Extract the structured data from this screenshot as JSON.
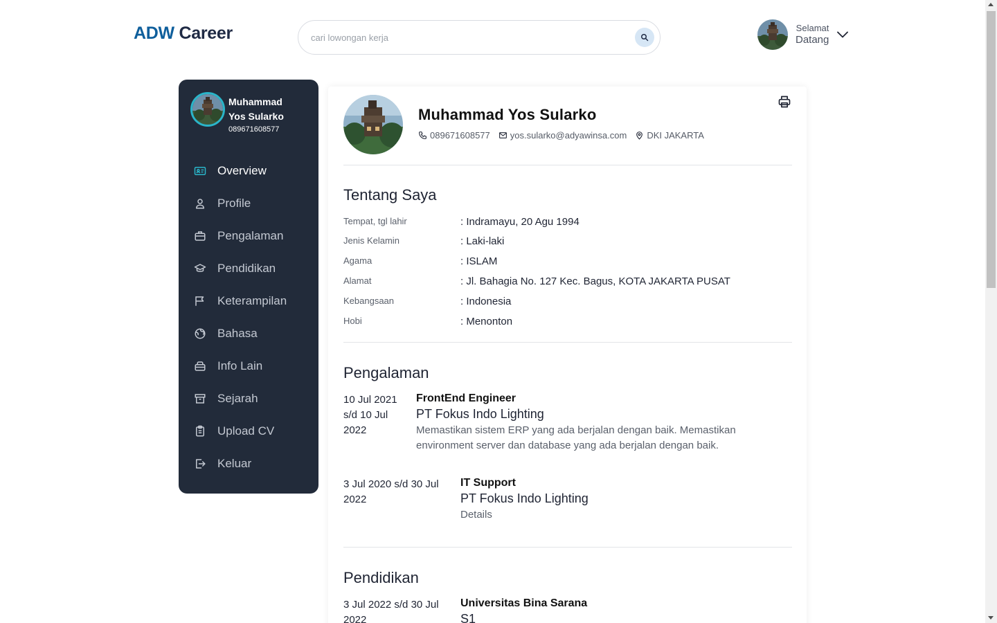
{
  "header": {
    "brand_part1": "ADW",
    "brand_part2": "Career",
    "search_placeholder": "cari lowongan kerja",
    "greeting_line1": "Selamat",
    "greeting_line2": "Datang"
  },
  "sidebar": {
    "name": "Muhammad Yos Sularko",
    "phone": "089671608577",
    "items": [
      {
        "label": "Overview",
        "icon": "id-card-icon",
        "active": true
      },
      {
        "label": "Profile",
        "icon": "user-icon"
      },
      {
        "label": "Pengalaman",
        "icon": "briefcase-icon"
      },
      {
        "label": "Pendidikan",
        "icon": "graduation-cap-icon"
      },
      {
        "label": "Keterampilan",
        "icon": "flag-icon"
      },
      {
        "label": "Bahasa",
        "icon": "globe-icon"
      },
      {
        "label": "Info Lain",
        "icon": "archive-box-icon"
      },
      {
        "label": "Sejarah",
        "icon": "archive-icon"
      },
      {
        "label": "Upload CV",
        "icon": "clipboard-icon"
      },
      {
        "label": "Keluar",
        "icon": "logout-icon"
      }
    ]
  },
  "profile": {
    "name": "Muhammad Yos Sularko",
    "phone": "089671608577",
    "email": "yos.sularko@adyawinsa.com",
    "location": "DKI JAKARTA"
  },
  "about": {
    "title": "Tentang Saya",
    "rows": [
      {
        "key": "Tempat, tgl lahir",
        "value": ": Indramayu, 20 Agu 1994"
      },
      {
        "key": "Jenis Kelamin",
        "value": ": Laki-laki"
      },
      {
        "key": "Agama",
        "value": ": ISLAM"
      },
      {
        "key": "Alamat",
        "value": ": Jl. Bahagia No. 127 Kec. Bagus, KOTA JAKARTA PUSAT"
      },
      {
        "key": "Kebangsaan",
        "value": ": Indonesia"
      },
      {
        "key": "Hobi",
        "value": ": Menonton"
      }
    ]
  },
  "experience": {
    "title": "Pengalaman",
    "items": [
      {
        "date": "10 Jul 2021 s/d 10 Jul 2022",
        "role": "FrontEnd Engineer",
        "company": "PT Fokus Indo Lighting",
        "desc": "Memastikan sistem ERP yang ada berjalan dengan baik. Memastikan environment server dan database yang ada berjalan dengan baik."
      },
      {
        "date": "3 Jul 2020 s/d 30 Jul 2022",
        "role": "IT Support",
        "company": "PT Fokus Indo Lighting",
        "desc": "Details"
      }
    ]
  },
  "education": {
    "title": "Pendidikan",
    "items": [
      {
        "date": "3 Jul 2022 s/d 30 Jul 2022",
        "school": "Universitas Bina Sarana",
        "degree": "S1"
      }
    ]
  },
  "colors": {
    "brand_blue": "#0f5f9c",
    "sidebar_bg": "#222b3a",
    "accent_cyan": "#2ab5c9"
  }
}
